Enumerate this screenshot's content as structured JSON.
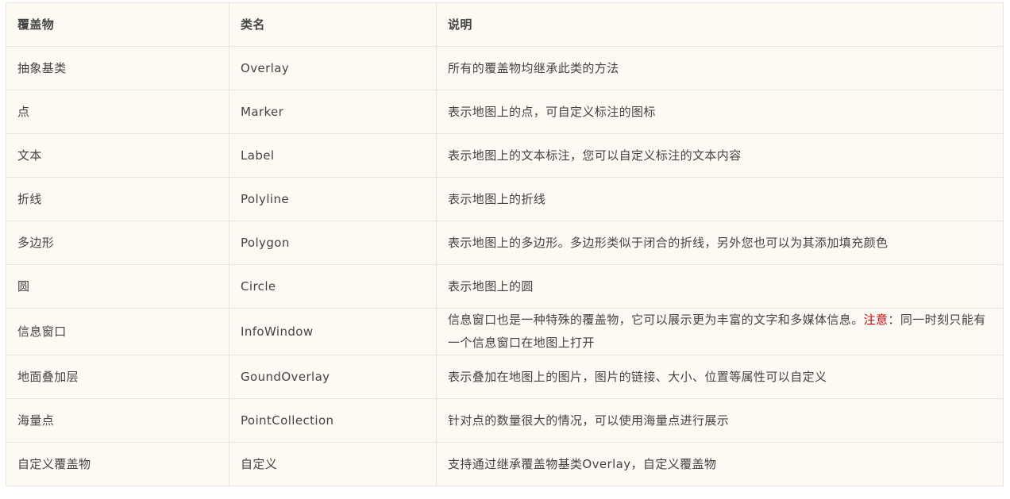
{
  "table": {
    "headers": [
      "覆盖物",
      "类名",
      "说明"
    ],
    "rows": [
      {
        "name": "抽象基类",
        "class": "Overlay",
        "desc": "所有的覆盖物均继承此类的方法"
      },
      {
        "name": "点",
        "class": "Marker",
        "desc": "表示地图上的点，可自定义标注的图标"
      },
      {
        "name": "文本",
        "class": "Label",
        "desc": "表示地图上的文本标注，您可以自定义标注的文本内容"
      },
      {
        "name": "折线",
        "class": "Polyline",
        "desc": "表示地图上的折线"
      },
      {
        "name": "多边形",
        "class": "Polygon",
        "desc": "表示地图上的多边形。多边形类似于闭合的折线，另外您也可以为其添加填充颜色"
      },
      {
        "name": "圆",
        "class": "Circle",
        "desc": "表示地图上的圆"
      },
      {
        "name": "信息窗口",
        "class": "InfoWindow",
        "desc_before": "信息窗口也是一种特殊的覆盖物，它可以展示更为丰富的文字和多媒体信息。",
        "note_label": "注意",
        "desc_after": "：同一时刻只能有一个信息窗口在地图上打开"
      },
      {
        "name": "地面叠加层",
        "class": "GoundOverlay",
        "desc": "表示叠加在地图上的图片，图片的链接、大小、位置等属性可以自定义"
      },
      {
        "name": "海量点",
        "class": "PointCollection",
        "desc": "针对点的数量很大的情况，可以使用海量点进行展示"
      },
      {
        "name": "自定义覆盖物",
        "class": "自定义",
        "desc": "支持通过继承覆盖物基类Overlay，自定义覆盖物"
      }
    ],
    "note_color": "#cc0000"
  }
}
